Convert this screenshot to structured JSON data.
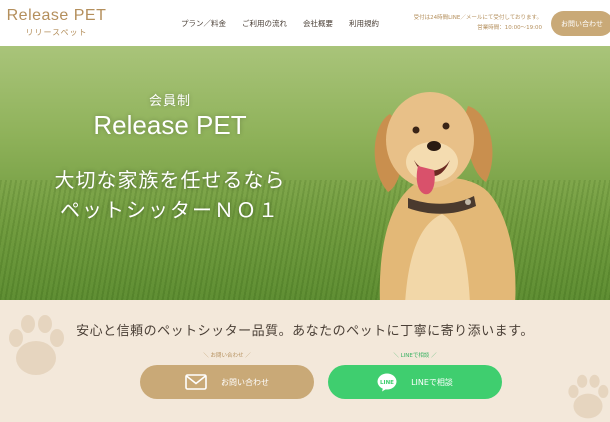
{
  "header": {
    "logo_main": "Release PET",
    "logo_sub": "リリースペット",
    "nav": [
      "プラン／料金",
      "ご利用の流れ",
      "会社概要",
      "利用規約"
    ],
    "hours_line1": "受付は24時間LINE／メールにて受付しております。",
    "hours_line2": "営業時間：10:00〜19:00",
    "contact_button": "お問い合わせ"
  },
  "hero": {
    "small": "会員制",
    "title": "Release PET",
    "copy1": "大切な家族を任せるなら",
    "copy2": "ペットシッターＮＯ１"
  },
  "bottom": {
    "tagline": "安心と信頼のペットシッター品質。あなたのペットに丁寧に寄り添います。",
    "contact_note": "＼ お問い合わせ ／",
    "contact_label": "お問い合わせ",
    "line_note": "＼ LINEで相談 ／",
    "line_label": "LINEで相談"
  },
  "icons": {
    "mail": "mail-icon",
    "line": "line-icon",
    "paw": "paw-icon",
    "dog": "dog-photo"
  },
  "colors": {
    "brand": "#c9a977",
    "line_green": "#3fce6f",
    "beige_bg": "#f3e8da"
  }
}
